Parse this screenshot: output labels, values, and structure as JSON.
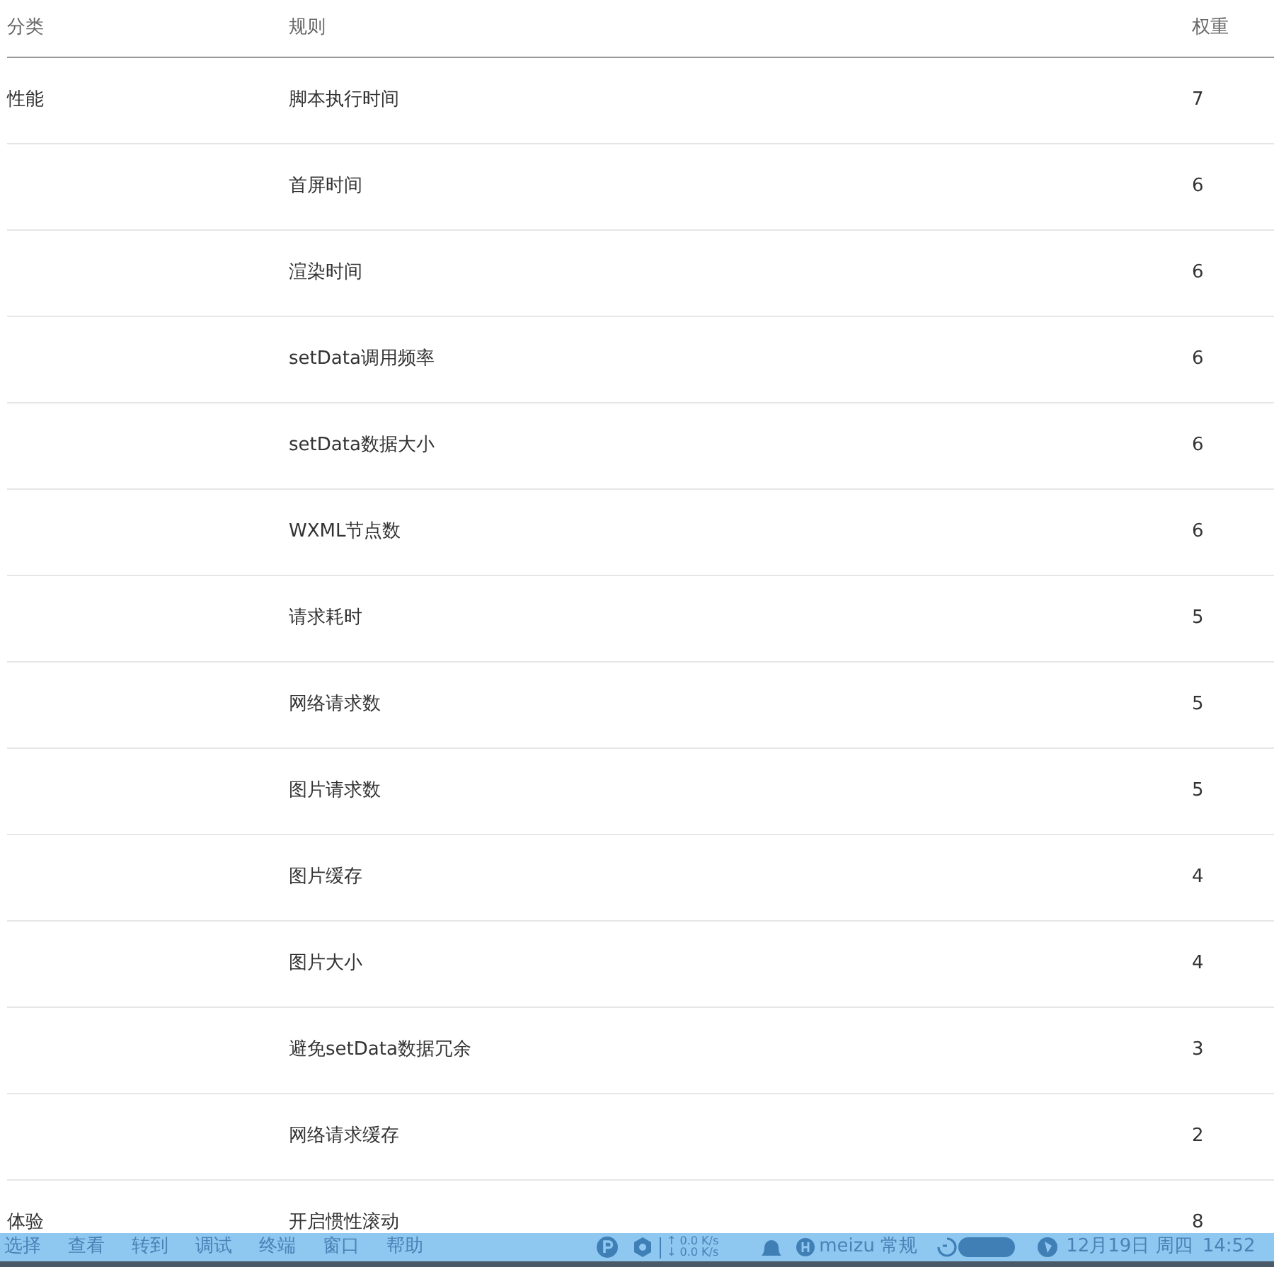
{
  "table": {
    "columns": [
      "分类",
      "规则",
      "权重"
    ],
    "rows": [
      {
        "category": "性能",
        "rule": "脚本执行时间",
        "weight": "7"
      },
      {
        "rule": "首屏时间",
        "weight": "6"
      },
      {
        "rule": "渲染时间",
        "weight": "6"
      },
      {
        "rule": "setData调用频率",
        "weight": "6"
      },
      {
        "rule": "setData数据大小",
        "weight": "6"
      },
      {
        "rule": "WXML节点数",
        "weight": "6"
      },
      {
        "rule": "请求耗时",
        "weight": "5"
      },
      {
        "rule": "网络请求数",
        "weight": "5"
      },
      {
        "rule": "图片请求数",
        "weight": "5"
      },
      {
        "rule": "图片缓存",
        "weight": "4"
      },
      {
        "rule": "图片大小",
        "weight": "4"
      },
      {
        "rule": "避免setData数据冗余",
        "weight": "3"
      },
      {
        "rule": "网络请求缓存",
        "weight": "2"
      },
      {
        "category": "体验",
        "rule": "开启惯性滚动",
        "weight": "8"
      }
    ]
  },
  "menu_bar": {
    "menus": [
      "选择",
      "查看",
      "转到",
      "调试",
      "终端",
      "窗口",
      "帮助"
    ],
    "net_up": "↑ 0.0 K/s",
    "net_down": "↓ 0.0 K/s",
    "input_method": "meizu 常规",
    "date": "12月19日 周四",
    "time": "14:52"
  }
}
